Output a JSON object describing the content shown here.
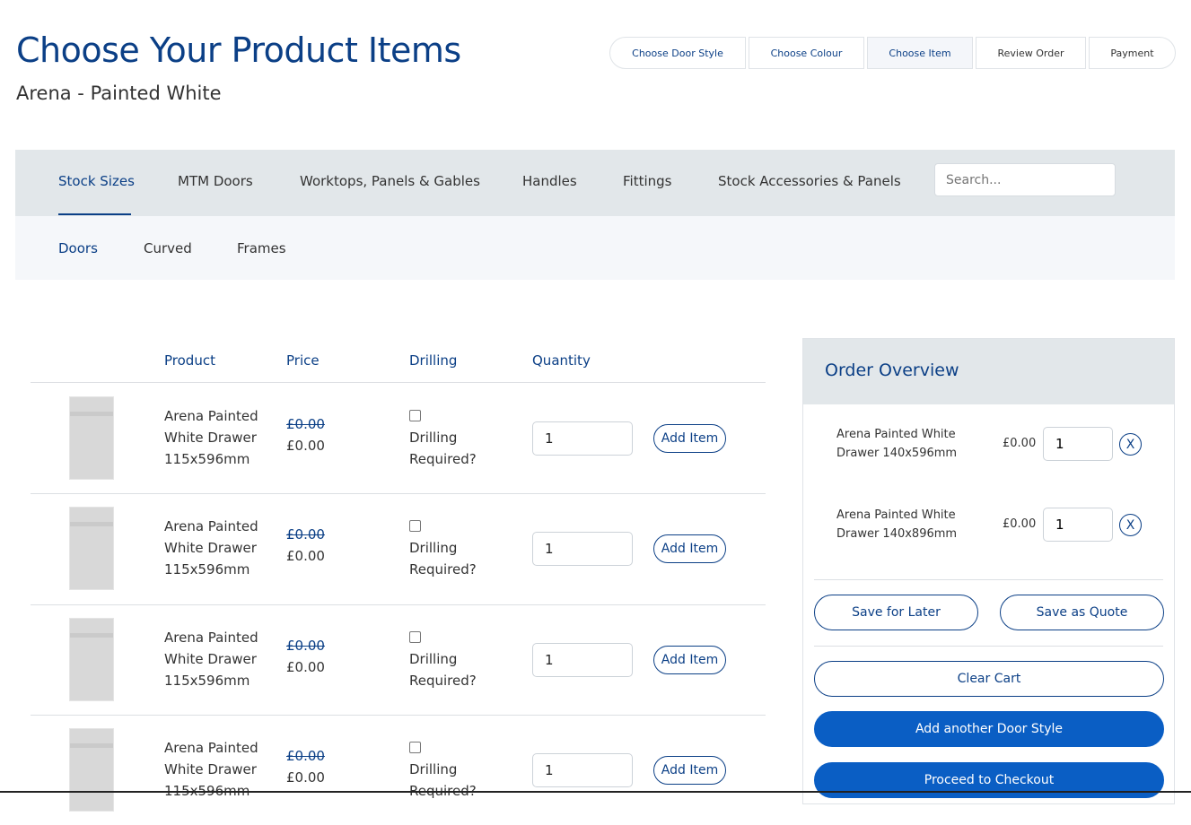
{
  "header": {
    "title": "Choose Your Product Items",
    "subtitle": "Arena - Painted White"
  },
  "steps": [
    "Choose Door Style",
    "Choose Colour",
    "Choose Item",
    "Review Order",
    "Payment"
  ],
  "nav": {
    "tabs": [
      "Stock Sizes",
      "MTM Doors",
      "Worktops, Panels & Gables",
      "Handles",
      "Fittings",
      "Stock Accessories & Panels"
    ],
    "search_placeholder": "Search..."
  },
  "subnav": [
    "Doors",
    "Curved",
    "Frames"
  ],
  "table": {
    "headers": [
      "Product",
      "Price",
      "Drilling",
      "Quantity"
    ],
    "rows": [
      {
        "name": "Arena Painted White Drawer 115x596mm",
        "old_price": "£0.00",
        "price": "£0.00",
        "drilling": "Drilling Required?",
        "qty": "1",
        "add": "Add Item"
      },
      {
        "name": "Arena Painted White Drawer 115x596mm",
        "old_price": "£0.00",
        "price": "£0.00",
        "drilling": "Drilling Required?",
        "qty": "1",
        "add": "Add Item"
      },
      {
        "name": "Arena Painted White Drawer 115x596mm",
        "old_price": "£0.00",
        "price": "£0.00",
        "drilling": "Drilling Required?",
        "qty": "1",
        "add": "Add Item"
      },
      {
        "name": "Arena Painted White Drawer 115x596mm",
        "old_price": "£0.00",
        "price": "£0.00",
        "drilling": "Drilling Required?",
        "qty": "1",
        "add": "Add Item"
      }
    ]
  },
  "order": {
    "title": "Order Overview",
    "items": [
      {
        "name": "Arena Painted White Drawer 140x596mm",
        "price": "£0.00",
        "qty": "1",
        "remove": "X"
      },
      {
        "name": "Arena Painted White Drawer 140x896mm",
        "price": "£0.00",
        "qty": "1",
        "remove": "X"
      }
    ],
    "save_later": "Save for Later",
    "save_quote": "Save as Quote",
    "clear": "Clear Cart",
    "add_style": "Add another Door Style",
    "checkout": "Proceed to Checkout"
  }
}
